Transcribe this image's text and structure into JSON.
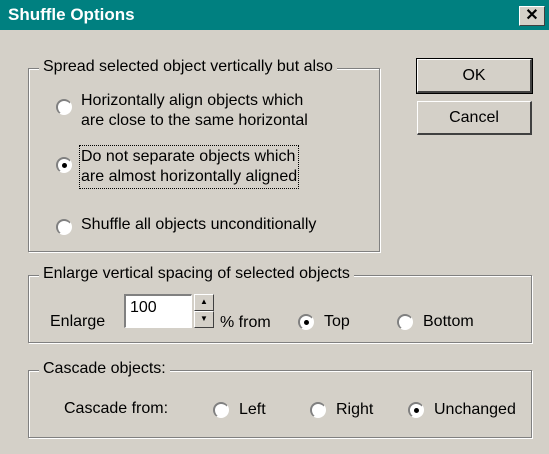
{
  "dialog": {
    "title": "Shuffle Options",
    "close_glyph": "✕"
  },
  "buttons": {
    "ok": "OK",
    "cancel": "Cancel"
  },
  "spread": {
    "legend": "Spread selected object vertically but also",
    "options": [
      {
        "line1": "Horizontally align objects which",
        "line2": "are close to the same horizontal",
        "selected": false
      },
      {
        "line1": "Do not separate objects which",
        "line2": "are almost horizontally aligned",
        "selected": true
      },
      {
        "line1": "Shuffle all objects unconditionally",
        "line2": "",
        "selected": false
      }
    ]
  },
  "enlarge": {
    "legend": "Enlarge vertical spacing of selected objects",
    "label": "Enlarge",
    "value": "100",
    "suffix": "% from",
    "options": [
      {
        "label": "Top",
        "selected": true
      },
      {
        "label": "Bottom",
        "selected": false
      }
    ]
  },
  "cascade": {
    "legend": "Cascade objects:",
    "label": "Cascade from:",
    "options": [
      {
        "label": "Left",
        "selected": false
      },
      {
        "label": "Right",
        "selected": false
      },
      {
        "label": "Unchanged",
        "selected": true
      }
    ]
  },
  "icons": {
    "spin_up": "▲",
    "spin_down": "▼"
  }
}
